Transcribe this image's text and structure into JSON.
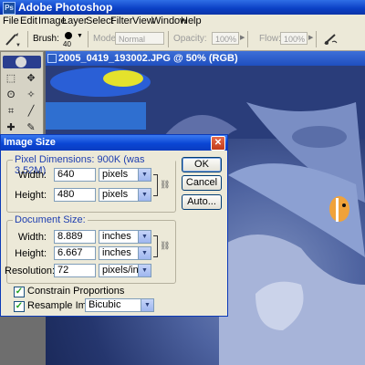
{
  "app": {
    "title": "Adobe Photoshop"
  },
  "menu": [
    "File",
    "Edit",
    "Image",
    "Layer",
    "Select",
    "Filter",
    "View",
    "Window",
    "Help"
  ],
  "options": {
    "brush_label": "Brush:",
    "brush_size": "40",
    "mode_label": "Mode:",
    "mode_value": "Normal",
    "opacity_label": "Opacity:",
    "opacity_value": "100%",
    "flow_label": "Flow:",
    "flow_value": "100%"
  },
  "document": {
    "title": "2005_0419_193002.JPG @ 50% (RGB)"
  },
  "dialog": {
    "title": "Image Size",
    "close": "✕",
    "pixel_dimensions": {
      "title": "Pixel Dimensions:  900K (was 3.52M)",
      "width_label": "Width:",
      "width_value": "640",
      "width_unit": "pixels",
      "height_label": "Height:",
      "height_value": "480",
      "height_unit": "pixels"
    },
    "document_size": {
      "title": "Document Size:",
      "width_label": "Width:",
      "width_value": "8.889",
      "width_unit": "inches",
      "height_label": "Height:",
      "height_value": "6.667",
      "height_unit": "inches",
      "resolution_label": "Resolution:",
      "resolution_value": "72",
      "resolution_unit": "pixels/inch"
    },
    "constrain_label": "Constrain Proportions",
    "constrain_checked": true,
    "resample_label": "Resample Image:",
    "resample_checked": true,
    "resample_value": "Bicubic",
    "buttons": {
      "ok": "OK",
      "cancel": "Cancel",
      "auto": "Auto..."
    }
  }
}
